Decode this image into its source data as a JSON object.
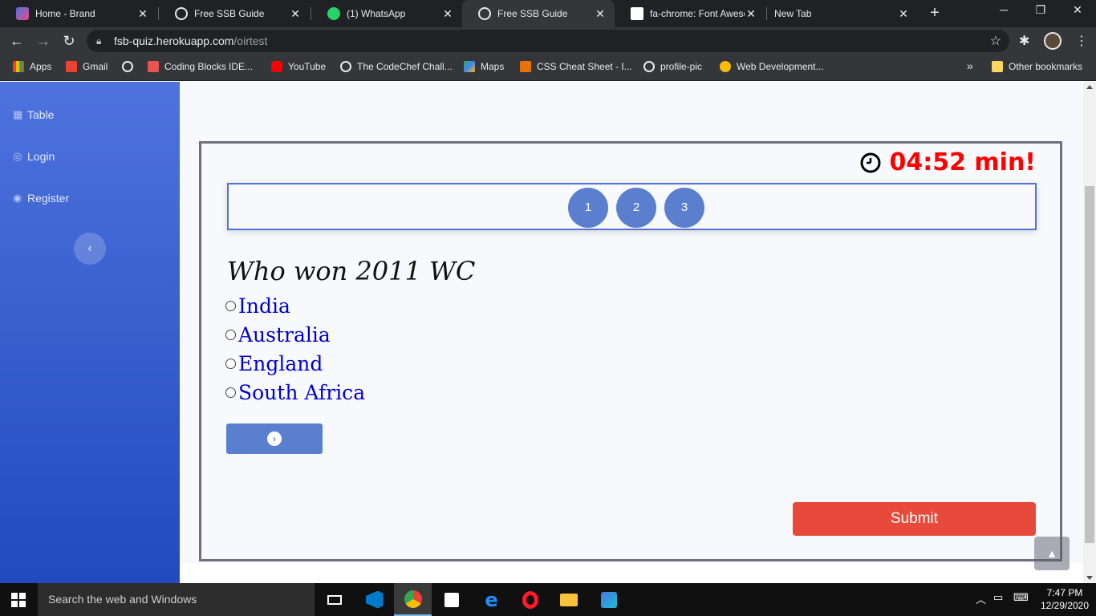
{
  "browser": {
    "tabs": [
      {
        "title": "Home - Brand",
        "favicon_color": "#4e73df"
      },
      {
        "title": "Free SSB Guide",
        "favicon_color": "#e8eaed"
      },
      {
        "title": "(1) WhatsApp",
        "favicon_color": "#25d366"
      },
      {
        "title": "Free SSB Guide",
        "favicon_color": "#e8eaed"
      },
      {
        "title": "fa-chrome: Font Aweso",
        "favicon_color": "#ffffff"
      },
      {
        "title": "New Tab",
        "favicon_color": ""
      }
    ],
    "active_tab_index": 3,
    "url_host": "fsb-quiz.herokuapp.com",
    "url_path": "/oirtest",
    "bookmarks": [
      {
        "label": "Apps",
        "icon": "apps-grid-icon",
        "color": "#f4b400"
      },
      {
        "label": "Gmail",
        "icon": "gmail-icon",
        "color": "#ea4335"
      },
      {
        "label": "",
        "icon": "globe-icon",
        "color": "#e8eaed"
      },
      {
        "label": "Coding Blocks IDE...",
        "icon": "coding-blocks-icon",
        "color": "#e8554e"
      },
      {
        "label": "YouTube",
        "icon": "youtube-icon",
        "color": "#ff0000"
      },
      {
        "label": "The CodeChef Chall...",
        "icon": "globe-icon",
        "color": "#e8eaed"
      },
      {
        "label": "Maps",
        "icon": "maps-icon",
        "color": "#34a853"
      },
      {
        "label": "CSS Cheat Sheet - I...",
        "icon": "css-icon",
        "color": "#e8710a"
      },
      {
        "label": "profile-pic",
        "icon": "globe-icon",
        "color": "#e8eaed"
      },
      {
        "label": "Web Development...",
        "icon": "web-dev-icon",
        "color": "#fbbc04"
      }
    ],
    "other_bookmarks": "Other bookmarks",
    "overflow": "»"
  },
  "sidebar": {
    "items": [
      {
        "label": "Table",
        "icon": "table-icon"
      },
      {
        "label": "Login",
        "icon": "user-circle-icon"
      },
      {
        "label": "Register",
        "icon": "user-circle-icon"
      }
    ],
    "toggle_symbol": "‹"
  },
  "quiz": {
    "timer": "04:52 min!",
    "timer_color": "#ff0000",
    "question_numbers": [
      "1",
      "2",
      "3"
    ],
    "question": "Who won 2011 WC",
    "options": [
      "India",
      "Australia",
      "England",
      "South Africa"
    ],
    "next_symbol": "›",
    "submit_label": "Submit",
    "submit_color": "#e74a3b"
  },
  "taskbar": {
    "search_placeholder": "Search the web and Windows",
    "time": "7:47 PM",
    "date": "12/29/2020"
  }
}
